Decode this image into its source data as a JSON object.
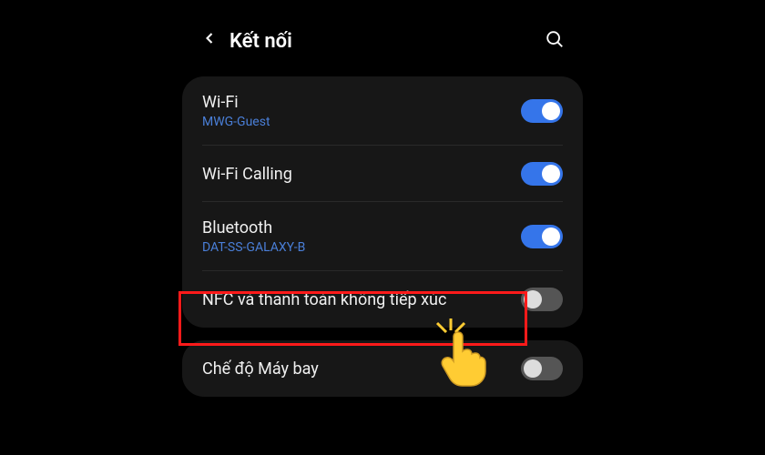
{
  "header": {
    "title": "Kết nối"
  },
  "group1": {
    "wifi": {
      "label": "Wi-Fi",
      "sublabel": "MWG-Guest",
      "enabled": true
    },
    "wifiCalling": {
      "label": "Wi-Fi Calling",
      "enabled": true
    },
    "bluetooth": {
      "label": "Bluetooth",
      "sublabel": "DAT-SS-GALAXY-B",
      "enabled": true
    },
    "nfc": {
      "label": "NFC và thanh toán không tiếp xúc",
      "enabled": false
    }
  },
  "group2": {
    "airplane": {
      "label": "Chế độ Máy bay",
      "enabled": false
    }
  },
  "highlight": {
    "target": "nfc"
  }
}
